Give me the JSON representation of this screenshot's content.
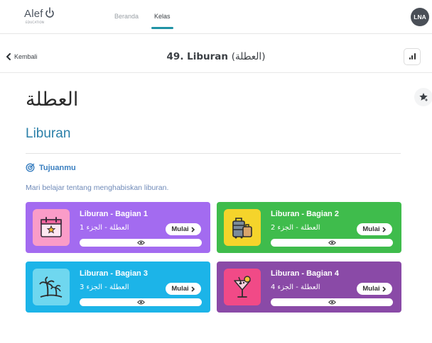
{
  "brand": {
    "name": "Alef",
    "sub": "EDUCATION"
  },
  "nav": {
    "items": [
      {
        "label": "Beranda"
      },
      {
        "label": "Kelas"
      }
    ]
  },
  "user": {
    "initials": "LNA"
  },
  "subbar": {
    "back_label": "Kembali",
    "title": "49. Liburan",
    "title_ar": "(العطلة)"
  },
  "content": {
    "arabic_title": "العطلة",
    "latin_title": "Liburan",
    "goal_label": "Tujuanmu",
    "goal_text": "Mari belajar tentang menghabiskan liburan."
  },
  "cards": [
    {
      "title": "Liburan - Bagian 1",
      "arabic": "العطلة - الجزء 1",
      "button": "Mulai",
      "icon": "calendar-icon",
      "color": "#a36bf0"
    },
    {
      "title": "Liburan - Bagian 2",
      "arabic": "العطلة - الجزء 2",
      "button": "Mulai",
      "icon": "luggage-icon",
      "color": "#3fbc4c"
    },
    {
      "title": "Liburan - Bagian 3",
      "arabic": "العطلة - الجزء 3",
      "button": "Mulai",
      "icon": "palm-tree-icon",
      "color": "#1cb4e8"
    },
    {
      "title": "Liburan - Bagian 4",
      "arabic": "العطلة - الجزء 4",
      "button": "Mulai",
      "icon": "cocktail-icon",
      "color": "#8a4aa7"
    }
  ],
  "colors": {
    "accent": "#1f93a5",
    "title_blue": "#2a7fa8",
    "goal_blue": "#3a7fc0"
  }
}
